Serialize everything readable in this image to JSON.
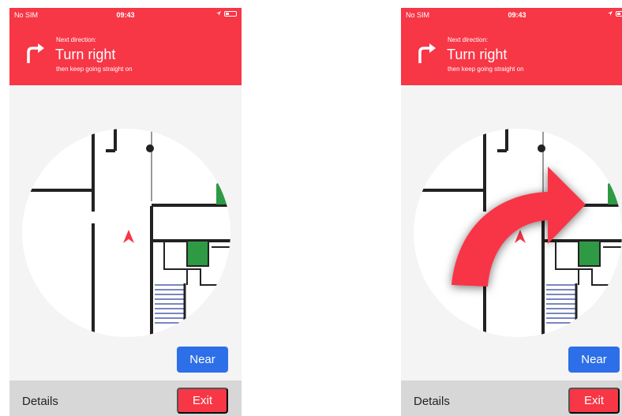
{
  "screens": [
    {
      "status": {
        "carrier": "No SIM",
        "time": "09:43"
      },
      "direction": {
        "label": "Next direction:",
        "instruction": "Turn right",
        "followup": "then keep going straight on",
        "icon": "turn-right-icon"
      },
      "near_label": "Near",
      "details_label": "Details",
      "exit_label": "Exit",
      "turn_overlay": false
    },
    {
      "status": {
        "carrier": "No SIM",
        "time": "09:43"
      },
      "direction": {
        "label": "Next direction:",
        "instruction": "Turn right",
        "followup": "then keep going straight on",
        "icon": "turn-right-icon"
      },
      "near_label": "Near",
      "details_label": "Details",
      "exit_label": "Exit",
      "turn_overlay": true
    }
  ],
  "colors": {
    "header": "#f73646",
    "near": "#2d6fe8",
    "exit": "#f73646",
    "footer": "#d7d7d7",
    "room": "#2e9a44",
    "stairs": "#2a3f9a"
  }
}
